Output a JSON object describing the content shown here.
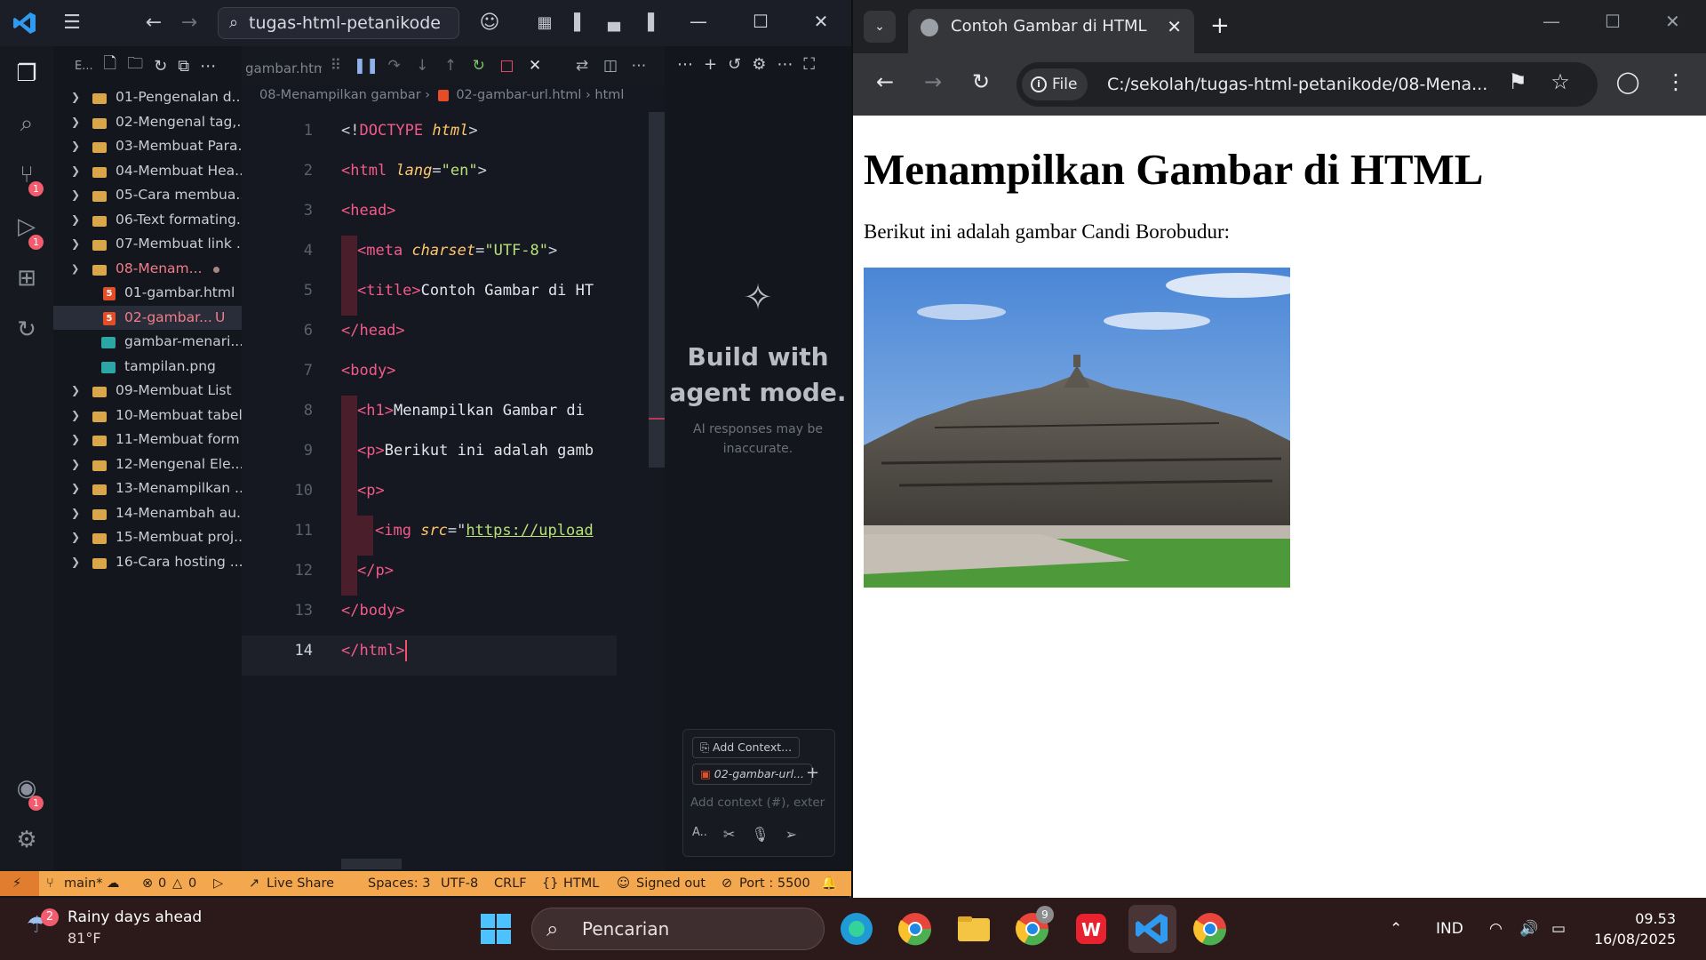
{
  "vscode": {
    "search_title": "tugas-html-petanikode",
    "explorer_header": "E...",
    "folders": [
      {
        "label": "01-Pengenalan d..."
      },
      {
        "label": "02-Mengenal tag,..."
      },
      {
        "label": "03-Membuat Para..."
      },
      {
        "label": "04-Membuat Hea..."
      },
      {
        "label": "05-Cara membua..."
      },
      {
        "label": "06-Text formating..."
      },
      {
        "label": "07-Membuat link ..."
      }
    ],
    "open_folder": "08-Menam...",
    "files": [
      {
        "label": "01-gambar.html",
        "type": "html"
      },
      {
        "label": "02-gambar...",
        "type": "html",
        "status": "U"
      },
      {
        "label": "gambar-menari...",
        "type": "image"
      },
      {
        "label": "tampilan.png",
        "type": "image"
      }
    ],
    "folders_after": [
      {
        "label": "09-Membuat List"
      },
      {
        "label": "10-Membuat tabel"
      },
      {
        "label": "11-Membuat form"
      },
      {
        "label": "12-Mengenal Ele..."
      },
      {
        "label": "13-Menampilkan ..."
      },
      {
        "label": "14-Menambah au..."
      },
      {
        "label": "15-Membuat proj..."
      },
      {
        "label": "16-Cara hosting ..."
      }
    ],
    "tab_label": "gambar.html",
    "breadcrumb": {
      "folder": "08-Menampilkan gambar",
      "file": "02-gambar-url.html",
      "symbol": "html"
    },
    "line_numbers": [
      "1",
      "2",
      "3",
      "4",
      "5",
      "6",
      "7",
      "8",
      "9",
      "10",
      "11",
      "12",
      "13",
      "14"
    ],
    "code": {
      "l1_open": "<!",
      "l1_kw": "DOCTYPE",
      "l1_attr": "html",
      "l1_close": ">",
      "l2_tag": "<html",
      "l2_attr": "lang",
      "l2_eq": "=",
      "l2_str": "\"en\"",
      "l2_close": ">",
      "l3": "<head>",
      "l4_tag": "<meta",
      "l4_attr": "charset",
      "l4_eq": "=",
      "l4_str": "\"UTF-8\"",
      "l4_close": ">",
      "l5_tag": "<title>",
      "l5_text": "Contoh Gambar di HT",
      "l6": "</head>",
      "l7": "<body>",
      "l8_tag": "<h1>",
      "l8_text": "Menampilkan Gambar di ",
      "l9_tag": "<p>",
      "l9_text": "Berikut ini adalah gamb",
      "l10": "<p>",
      "l11_tag": "<img",
      "l11_attr": "src",
      "l11_eq": "=\"",
      "l11_url": "https://upload",
      "l12": "</p>",
      "l13": "</body>",
      "l14": "</html>"
    },
    "chat": {
      "title": "Build with agent mode.",
      "subtitle": "AI responses may be inaccurate.",
      "add_context": "Add Context...",
      "file_chip": "02-gambar-url...",
      "placeholder": "Add context (#), exter",
      "mode": "A.."
    },
    "status": {
      "branch": "main*",
      "errors": "0",
      "warnings": "0",
      "live_share": "Live Share",
      "spaces": "Spaces: 3",
      "encoding": "UTF-8",
      "eol": "CRLF",
      "language": "HTML",
      "signed_out": "Signed out",
      "port": "Port : 5500"
    },
    "badges": {
      "scm": "1",
      "run": "1",
      "account": "1"
    }
  },
  "chrome": {
    "tab_title": "Contoh Gambar di HTML",
    "file_chip": "File",
    "url": "C:/sekolah/tugas-html-petanikode/08-Mena...",
    "page": {
      "h1": "Menampilkan Gambar di HTML",
      "paragraph": "Berikut ini adalah gambar Candi Borobudur:"
    }
  },
  "taskbar": {
    "weather_title": "Rainy days ahead",
    "weather_temp": "81°F",
    "weather_badge": "2",
    "search": "Pencarian",
    "chrome_badge": "9",
    "language": "IND",
    "time": "09.53",
    "date": "16/08/2025"
  },
  "colors": {
    "statusbar": "#f3a84f",
    "accent_red": "#f25c6e",
    "tag": "#f35a8a",
    "attr": "#ffc66d",
    "string": "#b7e07a"
  }
}
